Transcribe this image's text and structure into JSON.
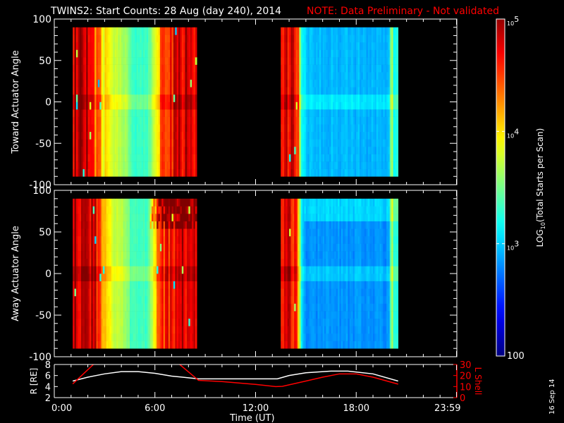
{
  "header": {
    "title": "TWINS2: Start Counts: 28 Aug (day 240), 2014",
    "note": "NOTE: Data Preliminary - Not validated",
    "note_color": "#ff0000"
  },
  "footer": {
    "date_stamp": "16 Sep 14"
  },
  "chart_data": [
    {
      "type": "heatmap",
      "name": "toward",
      "ylabel": "Toward Actuator Angle",
      "ylim": [
        -100,
        100
      ],
      "yticks": [
        "100",
        "50",
        "0",
        "-50",
        "-100"
      ],
      "xlim_hours": [
        0,
        24
      ],
      "angle_range": [
        -90,
        90
      ],
      "time_blocks": [
        {
          "start": 1.1,
          "end": 8.5,
          "log_counts": [
            [
              1.1,
              4.8
            ],
            [
              2.0,
              4.85
            ],
            [
              2.3,
              4.4
            ],
            [
              3.0,
              4.0
            ],
            [
              3.5,
              3.75
            ],
            [
              4.3,
              3.55
            ],
            [
              4.6,
              3.3
            ],
            [
              5.5,
              3.3
            ],
            [
              5.8,
              3.5
            ],
            [
              6.2,
              4.0
            ],
            [
              6.6,
              4.5
            ],
            [
              7.2,
              4.7
            ],
            [
              8.5,
              4.75
            ]
          ]
        },
        {
          "start": 13.5,
          "end": 20.5,
          "log_counts": [
            [
              13.5,
              4.75
            ],
            [
              14.5,
              4.6
            ],
            [
              14.7,
              3.3
            ],
            [
              15.0,
              2.95
            ],
            [
              20.0,
              2.9
            ],
            [
              20.1,
              3.9
            ],
            [
              20.25,
              3.2
            ],
            [
              20.5,
              3.2
            ]
          ]
        }
      ]
    },
    {
      "type": "heatmap",
      "name": "away",
      "ylabel": "Away Actuator Angle",
      "ylim": [
        -100,
        100
      ],
      "yticks": [
        "100",
        "50",
        "0",
        "-50",
        "-100"
      ],
      "xlim_hours": [
        0,
        24
      ],
      "angle_range": [
        -90,
        90
      ],
      "time_blocks": [
        {
          "start": 1.1,
          "end": 8.5,
          "log_counts": [
            [
              1.1,
              4.8
            ],
            [
              2.0,
              4.85
            ],
            [
              2.6,
              4.6
            ],
            [
              3.0,
              4.1
            ],
            [
              3.5,
              3.75
            ],
            [
              4.3,
              3.6
            ],
            [
              4.6,
              3.3
            ],
            [
              5.5,
              3.3
            ],
            [
              5.8,
              3.6
            ],
            [
              6.2,
              4.2
            ],
            [
              6.6,
              4.5
            ],
            [
              7.2,
              4.7
            ],
            [
              8.5,
              4.75
            ]
          ]
        },
        {
          "start": 13.5,
          "end": 20.5,
          "log_counts": [
            [
              13.5,
              4.75
            ],
            [
              14.5,
              4.6
            ],
            [
              14.7,
              3.2
            ],
            [
              15.0,
              2.8
            ],
            [
              20.0,
              2.8
            ],
            [
              20.1,
              3.9
            ],
            [
              20.25,
              3.2
            ],
            [
              20.5,
              3.2
            ]
          ]
        }
      ]
    },
    {
      "type": "line",
      "name": "orbit",
      "xlabel": "Time (UT)",
      "xticks": [
        "0:00",
        "6:00",
        "12:00",
        "18:00",
        "23:59"
      ],
      "ylabel_left": "R [RE]",
      "ylim_left": [
        2,
        8
      ],
      "yticks_left": [
        "2",
        "4",
        "6",
        "8"
      ],
      "ylabel_right": "L Shell",
      "ylim_right": [
        0,
        30
      ],
      "yticks_right": [
        "0",
        "10",
        "20",
        "30"
      ],
      "series": [
        {
          "name": "R",
          "color": "#ffffff",
          "axis": "left",
          "points": [
            [
              1.1,
              5.0
            ],
            [
              2,
              5.7
            ],
            [
              3,
              6.3
            ],
            [
              4,
              6.7
            ],
            [
              5,
              6.7
            ],
            [
              6,
              6.4
            ],
            [
              7,
              5.9
            ],
            [
              8.6,
              5.4
            ],
            [
              13.3,
              5.4
            ],
            [
              14,
              6.0
            ],
            [
              15,
              6.5
            ],
            [
              16.5,
              6.8
            ],
            [
              17.5,
              6.8
            ],
            [
              19,
              6.3
            ],
            [
              20.5,
              5.0
            ]
          ]
        },
        {
          "name": "L Shell",
          "color": "#ff0000",
          "axis": "right",
          "segments": [
            [
              [
                1.1,
                12.4
              ],
              [
                2.4,
                31
              ]
            ],
            [
              [
                7.4,
                31
              ],
              [
                8.6,
                15.6
              ],
              [
                10,
                14.5
              ],
              [
                12,
                12
              ],
              [
                13.2,
                10
              ],
              [
                13.6,
                10.2
              ],
              [
                15,
                15
              ],
              [
                16,
                18.5
              ],
              [
                17,
                21.5
              ],
              [
                18,
                21.5
              ],
              [
                19,
                18.5
              ],
              [
                20.5,
                12.2
              ]
            ]
          ]
        }
      ]
    },
    {
      "type": "colorbar",
      "name": "colorbar",
      "label_prefix": "LOG",
      "label_sub": "10",
      "label_rest": "(Total Starts per Scan)",
      "range_log10": [
        2,
        5
      ],
      "ticks": [
        {
          "base": "10",
          "exp": "5"
        },
        {
          "base": "10",
          "exp": "4"
        },
        {
          "base": "10",
          "exp": "3"
        },
        {
          "base": "100",
          "exp": ""
        }
      ]
    }
  ]
}
